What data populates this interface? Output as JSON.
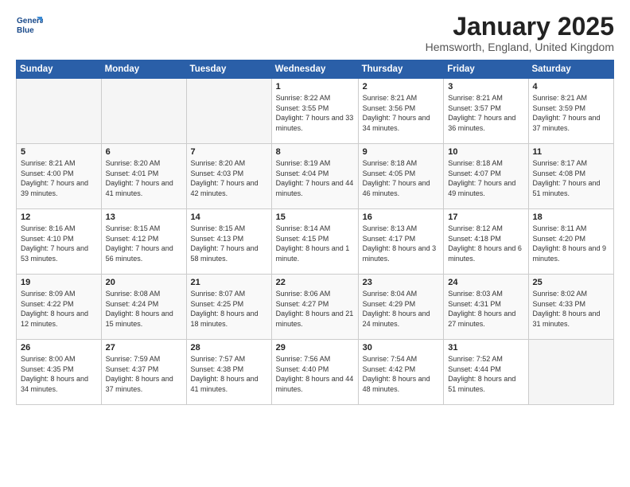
{
  "header": {
    "logo_line1": "General",
    "logo_line2": "Blue",
    "title": "January 2025",
    "location": "Hemsworth, England, United Kingdom"
  },
  "days_of_week": [
    "Sunday",
    "Monday",
    "Tuesday",
    "Wednesday",
    "Thursday",
    "Friday",
    "Saturday"
  ],
  "weeks": [
    [
      {
        "day": "",
        "info": ""
      },
      {
        "day": "",
        "info": ""
      },
      {
        "day": "",
        "info": ""
      },
      {
        "day": "1",
        "info": "Sunrise: 8:22 AM\nSunset: 3:55 PM\nDaylight: 7 hours and 33 minutes."
      },
      {
        "day": "2",
        "info": "Sunrise: 8:21 AM\nSunset: 3:56 PM\nDaylight: 7 hours and 34 minutes."
      },
      {
        "day": "3",
        "info": "Sunrise: 8:21 AM\nSunset: 3:57 PM\nDaylight: 7 hours and 36 minutes."
      },
      {
        "day": "4",
        "info": "Sunrise: 8:21 AM\nSunset: 3:59 PM\nDaylight: 7 hours and 37 minutes."
      }
    ],
    [
      {
        "day": "5",
        "info": "Sunrise: 8:21 AM\nSunset: 4:00 PM\nDaylight: 7 hours and 39 minutes."
      },
      {
        "day": "6",
        "info": "Sunrise: 8:20 AM\nSunset: 4:01 PM\nDaylight: 7 hours and 41 minutes."
      },
      {
        "day": "7",
        "info": "Sunrise: 8:20 AM\nSunset: 4:03 PM\nDaylight: 7 hours and 42 minutes."
      },
      {
        "day": "8",
        "info": "Sunrise: 8:19 AM\nSunset: 4:04 PM\nDaylight: 7 hours and 44 minutes."
      },
      {
        "day": "9",
        "info": "Sunrise: 8:18 AM\nSunset: 4:05 PM\nDaylight: 7 hours and 46 minutes."
      },
      {
        "day": "10",
        "info": "Sunrise: 8:18 AM\nSunset: 4:07 PM\nDaylight: 7 hours and 49 minutes."
      },
      {
        "day": "11",
        "info": "Sunrise: 8:17 AM\nSunset: 4:08 PM\nDaylight: 7 hours and 51 minutes."
      }
    ],
    [
      {
        "day": "12",
        "info": "Sunrise: 8:16 AM\nSunset: 4:10 PM\nDaylight: 7 hours and 53 minutes."
      },
      {
        "day": "13",
        "info": "Sunrise: 8:15 AM\nSunset: 4:12 PM\nDaylight: 7 hours and 56 minutes."
      },
      {
        "day": "14",
        "info": "Sunrise: 8:15 AM\nSunset: 4:13 PM\nDaylight: 7 hours and 58 minutes."
      },
      {
        "day": "15",
        "info": "Sunrise: 8:14 AM\nSunset: 4:15 PM\nDaylight: 8 hours and 1 minute."
      },
      {
        "day": "16",
        "info": "Sunrise: 8:13 AM\nSunset: 4:17 PM\nDaylight: 8 hours and 3 minutes."
      },
      {
        "day": "17",
        "info": "Sunrise: 8:12 AM\nSunset: 4:18 PM\nDaylight: 8 hours and 6 minutes."
      },
      {
        "day": "18",
        "info": "Sunrise: 8:11 AM\nSunset: 4:20 PM\nDaylight: 8 hours and 9 minutes."
      }
    ],
    [
      {
        "day": "19",
        "info": "Sunrise: 8:09 AM\nSunset: 4:22 PM\nDaylight: 8 hours and 12 minutes."
      },
      {
        "day": "20",
        "info": "Sunrise: 8:08 AM\nSunset: 4:24 PM\nDaylight: 8 hours and 15 minutes."
      },
      {
        "day": "21",
        "info": "Sunrise: 8:07 AM\nSunset: 4:25 PM\nDaylight: 8 hours and 18 minutes."
      },
      {
        "day": "22",
        "info": "Sunrise: 8:06 AM\nSunset: 4:27 PM\nDaylight: 8 hours and 21 minutes."
      },
      {
        "day": "23",
        "info": "Sunrise: 8:04 AM\nSunset: 4:29 PM\nDaylight: 8 hours and 24 minutes."
      },
      {
        "day": "24",
        "info": "Sunrise: 8:03 AM\nSunset: 4:31 PM\nDaylight: 8 hours and 27 minutes."
      },
      {
        "day": "25",
        "info": "Sunrise: 8:02 AM\nSunset: 4:33 PM\nDaylight: 8 hours and 31 minutes."
      }
    ],
    [
      {
        "day": "26",
        "info": "Sunrise: 8:00 AM\nSunset: 4:35 PM\nDaylight: 8 hours and 34 minutes."
      },
      {
        "day": "27",
        "info": "Sunrise: 7:59 AM\nSunset: 4:37 PM\nDaylight: 8 hours and 37 minutes."
      },
      {
        "day": "28",
        "info": "Sunrise: 7:57 AM\nSunset: 4:38 PM\nDaylight: 8 hours and 41 minutes."
      },
      {
        "day": "29",
        "info": "Sunrise: 7:56 AM\nSunset: 4:40 PM\nDaylight: 8 hours and 44 minutes."
      },
      {
        "day": "30",
        "info": "Sunrise: 7:54 AM\nSunset: 4:42 PM\nDaylight: 8 hours and 48 minutes."
      },
      {
        "day": "31",
        "info": "Sunrise: 7:52 AM\nSunset: 4:44 PM\nDaylight: 8 hours and 51 minutes."
      },
      {
        "day": "",
        "info": ""
      }
    ]
  ]
}
